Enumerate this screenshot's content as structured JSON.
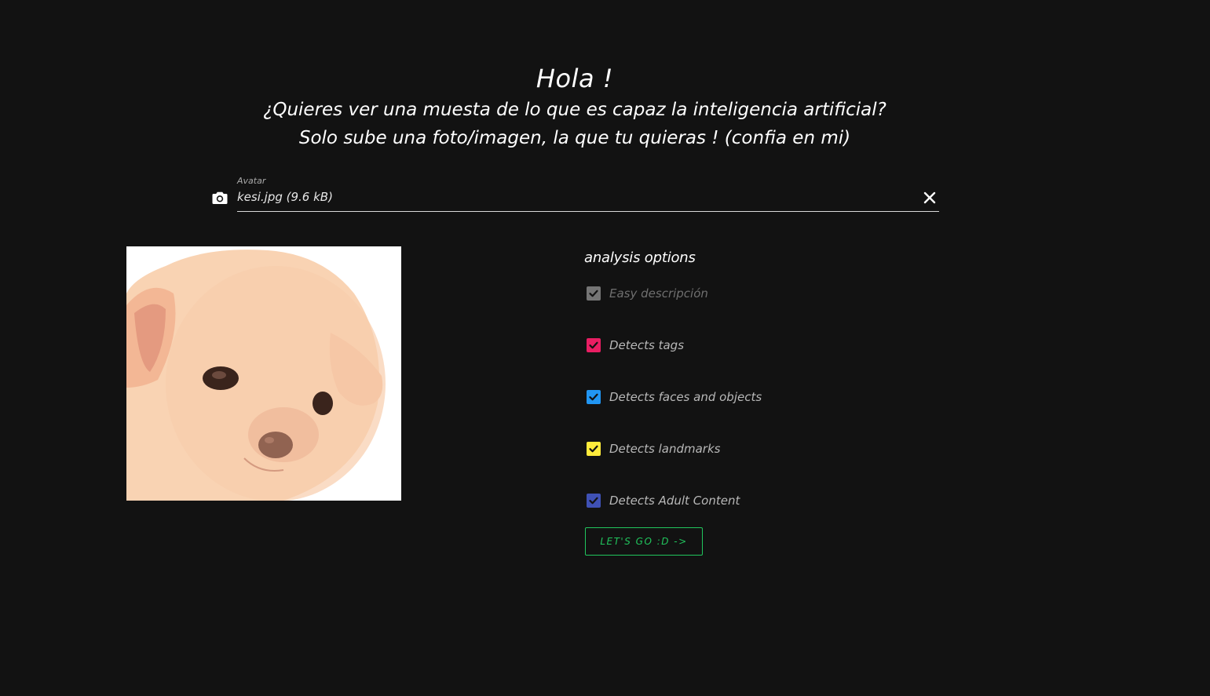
{
  "hero": {
    "title": "Hola !",
    "line1": "¿Quieres ver una muesta de lo que es capaz la inteligencia artificial?",
    "line2": "Solo sube una foto/imagen, la que tu quieras ! (confia en mi)"
  },
  "upload": {
    "label": "Avatar",
    "value": "kesi.jpg (9.6 kB)",
    "icon": "camera-icon",
    "clear_icon": "close-icon"
  },
  "preview": {
    "icon": "puppy-image"
  },
  "options": {
    "title": "analysis options",
    "items": [
      {
        "label": "Easy descripción",
        "checked": true,
        "disabled": true,
        "color": "#757575"
      },
      {
        "label": "Detects tags",
        "checked": true,
        "disabled": false,
        "color": "#e91e63"
      },
      {
        "label": "Detects faces and objects",
        "checked": true,
        "disabled": false,
        "color": "#2196f3"
      },
      {
        "label": "Detects landmarks",
        "checked": true,
        "disabled": false,
        "color": "#ffeb3b"
      },
      {
        "label": "Detects Adult Content",
        "checked": true,
        "disabled": false,
        "color": "#3f51b5"
      }
    ]
  },
  "action": {
    "label": "LET'S GO :D ->",
    "color": "#21c55d"
  },
  "colors": {
    "background": "#121212",
    "text": "#ffffff",
    "muted": "#b8b8b8"
  }
}
